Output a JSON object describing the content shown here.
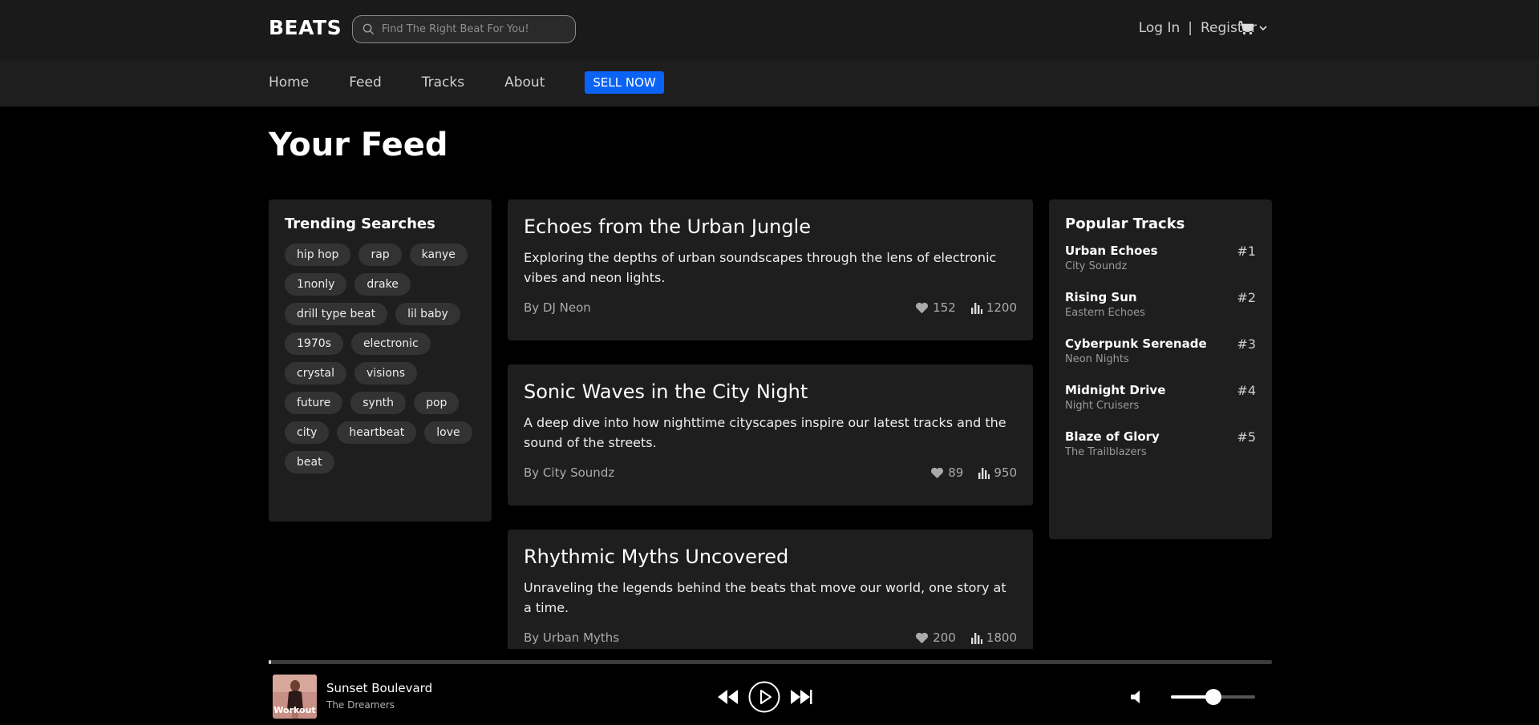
{
  "header": {
    "brand": "BEATS",
    "search_placeholder": "Find The Right Beat For You!",
    "login": "Log In",
    "separator": "|",
    "register": "Register"
  },
  "nav": {
    "items": [
      "Home",
      "Feed",
      "Tracks",
      "About"
    ],
    "sell": "SELL NOW"
  },
  "page_title": "Your Feed",
  "trending": {
    "title": "Trending Searches",
    "tags": [
      "hip hop",
      "rap",
      "kanye",
      "1nonly",
      "drake",
      "drill type beat",
      "lil baby",
      "1970s",
      "electronic",
      "crystal",
      "visions",
      "future",
      "synth",
      "pop",
      "city",
      "heartbeat",
      "love",
      "beat"
    ]
  },
  "posts": [
    {
      "title": "Echoes from the Urban Jungle",
      "body": "Exploring the depths of urban soundscapes through the lens of electronic vibes and neon lights.",
      "author": "By DJ Neon",
      "likes": "152",
      "plays": "1200"
    },
    {
      "title": "Sonic Waves in the City Night",
      "body": "A deep dive into how nighttime cityscapes inspire our latest tracks and the sound of the streets.",
      "author": "By City Soundz",
      "likes": "89",
      "plays": "950"
    },
    {
      "title": "Rhythmic Myths Uncovered",
      "body": "Unraveling the legends behind the beats that move our world, one story at a time.",
      "author": "By Urban Myths",
      "likes": "200",
      "plays": "1800"
    }
  ],
  "popular": {
    "title": "Popular Tracks",
    "tracks": [
      {
        "title": "Urban Echoes",
        "artist": "City Soundz",
        "rank": "#1"
      },
      {
        "title": "Rising Sun",
        "artist": "Eastern Echoes",
        "rank": "#2"
      },
      {
        "title": "Cyberpunk Serenade",
        "artist": "Neon Nights",
        "rank": "#3"
      },
      {
        "title": "Midnight Drive",
        "artist": "Night Cruisers",
        "rank": "#4"
      },
      {
        "title": "Blaze of Glory",
        "artist": "The Trailblazers",
        "rank": "#5"
      }
    ]
  },
  "player": {
    "cover_label": "Workout",
    "song": "Sunset Boulevard",
    "artist": "The Dreamers",
    "progress": 0.002,
    "volume": 0.5
  },
  "colors": {
    "accent": "#0b63f6",
    "panel": "#1e1e1e",
    "background": "#000000"
  }
}
